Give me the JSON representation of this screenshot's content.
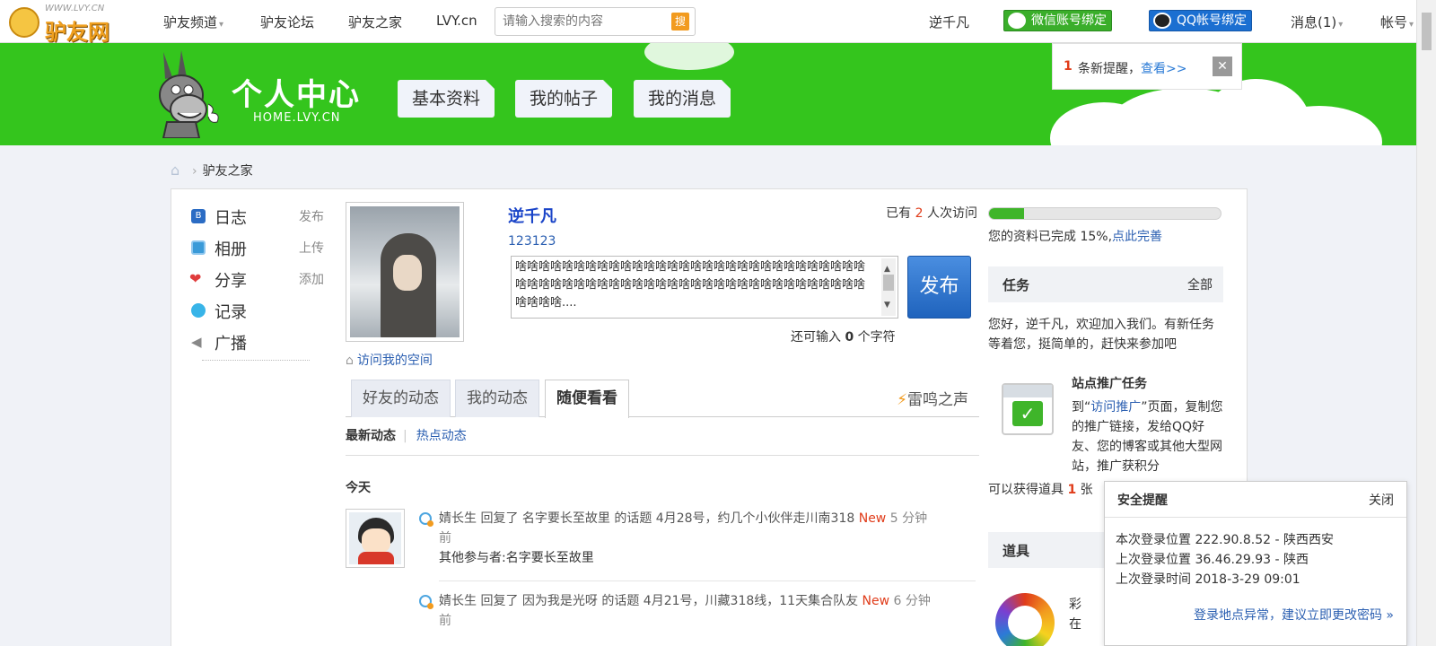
{
  "topbar": {
    "logo_url": "WWW.LVY.CN",
    "logo_name": "驴友网",
    "nav": [
      {
        "label": "驴友频道",
        "caret": "▾"
      },
      {
        "label": "驴友论坛"
      },
      {
        "label": "驴友之家"
      },
      {
        "label": "LVY.cn"
      }
    ],
    "search_placeholder": "请输入搜索的内容",
    "search_button": "搜",
    "username": "逆千凡",
    "wechat_bind": "微信账号绑定",
    "qq_bind": "QQ帐号绑定",
    "messages": "消息(1)",
    "account": "帐号"
  },
  "banner": {
    "title": "个人中心",
    "subtitle": "HOME.LVY.CN",
    "tabs": [
      "基本资料",
      "我的帖子",
      "我的消息"
    ]
  },
  "notice": {
    "count": "1",
    "text": "条新提醒，",
    "view": "查看>>",
    "close": "✕"
  },
  "breadcrumb": {
    "home_icon": "home-icon",
    "separator": "›",
    "current": "驴友之家"
  },
  "leftnav": {
    "items": [
      {
        "label": "日志",
        "action": "发布",
        "icon": "blog-icon",
        "color": "#2b6cc4"
      },
      {
        "label": "相册",
        "action": "上传",
        "icon": "album-icon",
        "color": "#3a9ad8"
      },
      {
        "label": "分享",
        "action": "添加",
        "icon": "share-icon",
        "color": "#e03c3c"
      },
      {
        "label": "记录",
        "action": "",
        "icon": "record-icon",
        "color": "#38b4e8"
      },
      {
        "label": "广播",
        "action": "",
        "icon": "broadcast-icon",
        "color": "#888888"
      }
    ]
  },
  "profile": {
    "name": "逆千凡",
    "sign": "123123",
    "visits_prefix": "已有",
    "visits_count": "2",
    "visits_suffix": "人次访问",
    "visit_space": "访问我的空间",
    "post_text": "啥啥啥啥啥啥啥啥啥啥啥啥啥啥啥啥啥啥啥啥啥啥啥啥啥啥啥啥啥啥啥啥啥啥啥啥啥啥啥啥啥啥啥啥啥啥啥啥啥啥啥啥啥啥啥啥啥啥啥啥啥啥啥啥....",
    "publish": "发布",
    "remain_prefix": "还可输入",
    "remain_count": "0",
    "remain_suffix": "个字符"
  },
  "tabs": {
    "items": [
      "好友的动态",
      "我的动态",
      "随便看看"
    ],
    "active_index": 2,
    "thunder": "雷鸣之声"
  },
  "subtabs": {
    "latest": "最新动态",
    "sep": "|",
    "hot": "热点动态"
  },
  "feed": {
    "today": "今天",
    "items": [
      {
        "user": "婧长生",
        "action": "回复了",
        "target": "名字要长至故里",
        "text": "的话题 4月28号，约几个小伙伴走川南318",
        "new": "New",
        "time": "5 分钟",
        "time2": "前",
        "others": "其他参与者:名字要长至故里"
      },
      {
        "user": "婧长生",
        "action": "回复了",
        "target": "因为我是光呀",
        "text": "的话题 4月21号，川藏318线，11天集合队友",
        "new": "New",
        "time": "6 分钟",
        "time2": "前",
        "others": ""
      }
    ]
  },
  "profile_progress": {
    "fraction": 0.15,
    "text": "您的资料已完成 15%,",
    "link": "点此完善"
  },
  "tasks": {
    "title": "任务",
    "all": "全部",
    "intro": "您好，逆千凡，欢迎加入我们。有新任务等着您，挺简单的，赶快来参加吧",
    "card_title": "站点推广任务",
    "card_desc_pre": "到“",
    "card_desc_link": "访问推广",
    "card_desc_post": "”页面，复制您的推广链接，发给QQ好友、您的博客或其他大型网站，推广获积分",
    "reward_pre": "可以获得道具",
    "reward_count": "1",
    "reward_post": "张"
  },
  "props": {
    "title": "道具",
    "line1": "彩",
    "line2": "在"
  },
  "security": {
    "title": "安全提醒",
    "close": "关闭",
    "current": "本次登录位置 222.90.8.52 - 陕西西安",
    "last": "上次登录位置 36.46.29.93 - 陕西",
    "last_time": "上次登录时间 2018-3-29 09:01",
    "warn": "登录地点异常，建议立即更改密码 »"
  },
  "colors": {
    "banner_green": "#34c51d",
    "link_blue": "#2b5fb1",
    "alert_red": "#e03c1a",
    "publish_blue": "#1f63bd"
  }
}
